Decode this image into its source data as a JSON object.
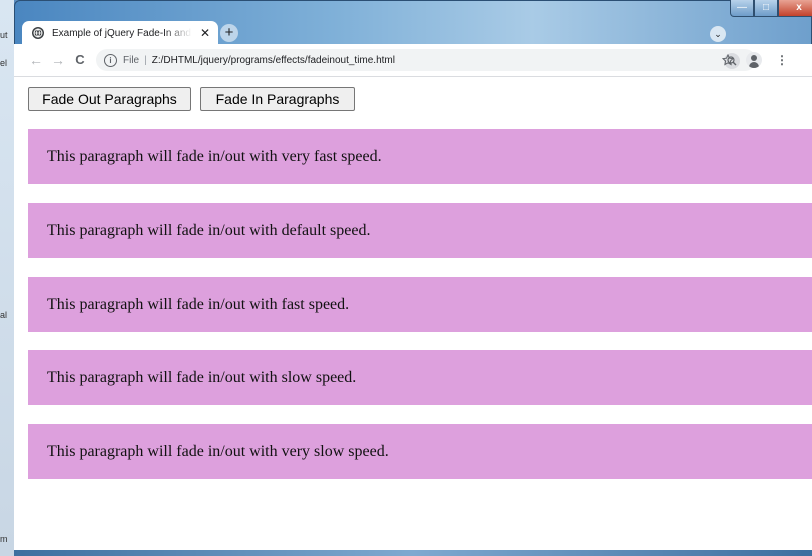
{
  "browser": {
    "tab_title": "Example of jQuery Fade-In and Fade-Out Effects with Different Speeds",
    "tab_close": "✕",
    "new_tab": "+",
    "tab_search": "⌄",
    "back": "←",
    "forward": "→",
    "reload": "C",
    "info_icon": "i",
    "file_label": "File",
    "separator": "|",
    "url": "Z:/DHTML/jquery/programs/effects/fadeinout_time.html",
    "menu": "⋮",
    "window_controls": {
      "minimize": "—",
      "maximize": "□",
      "close": "x"
    }
  },
  "page": {
    "buttons": {
      "fade_out": "Fade Out Paragraphs",
      "fade_in": "Fade In Paragraphs"
    },
    "paragraphs": [
      "This paragraph will fade in/out with very fast speed.",
      "This paragraph will fade in/out with default speed.",
      "This paragraph will fade in/out with fast speed.",
      "This paragraph will fade in/out with slow speed.",
      "This paragraph will fade in/out with very slow speed."
    ],
    "paragraph_color": "#dda0dd"
  }
}
